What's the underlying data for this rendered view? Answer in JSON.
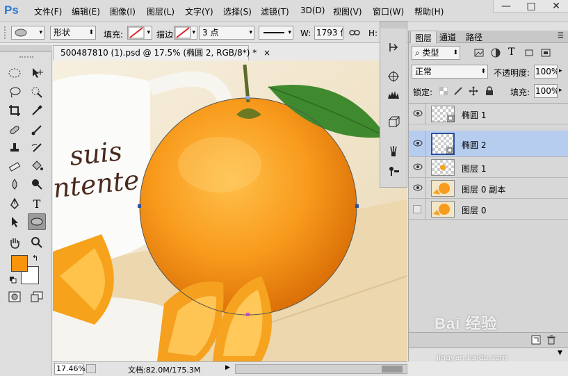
{
  "app": {
    "logo": "Ps"
  },
  "menu": [
    "文件(F)",
    "编辑(E)",
    "图像(I)",
    "图层(L)",
    "文字(Y)",
    "选择(S)",
    "滤镜(T)",
    "3D(D)",
    "视图(V)",
    "窗口(W)",
    "帮助(H)"
  ],
  "window_controls": {
    "minimize": "—",
    "restore": "□",
    "close": "✕"
  },
  "options": {
    "shape_mode": "形状",
    "fill_label": "填充:",
    "stroke_label": "描边:",
    "stroke_width": "3 点",
    "w_label": "W:",
    "w_value": "1793 像",
    "h_label": "H:"
  },
  "document": {
    "tab_title": "500487810 (1).psd @ 17.5% (椭圆 2, RGB/8*) *",
    "close": "×",
    "mug_text_line1": "suis",
    "mug_text_line2": "ntente"
  },
  "status": {
    "zoom": "17.46%",
    "doc_info": "文档:82.0M/175.3M"
  },
  "colors": {
    "foreground": "#f7940c",
    "background": "#ffffff",
    "accent_selection": "#b7cdf0"
  },
  "layers_panel": {
    "tabs": [
      "图层",
      "通道",
      "路径"
    ],
    "filter_kind": "类型",
    "blend_mode": "正常",
    "opacity_label": "不透明度:",
    "opacity_value": "100%",
    "lock_label": "锁定:",
    "fill_label": "填充:",
    "fill_value": "100%",
    "layers": [
      {
        "name": "椭圆 1",
        "visible": true,
        "selected": false,
        "type": "shape"
      },
      {
        "name": "椭圆 2",
        "visible": true,
        "selected": true,
        "type": "shape"
      },
      {
        "name": "图层 1",
        "visible": true,
        "selected": false,
        "type": "pixel"
      },
      {
        "name": "图层 0 副本",
        "visible": true,
        "selected": false,
        "type": "image"
      },
      {
        "name": "图层 0",
        "visible": false,
        "selected": false,
        "type": "image"
      }
    ]
  },
  "watermark": {
    "brand": "Bai 经验",
    "url": "jingyan.baidu.com"
  }
}
